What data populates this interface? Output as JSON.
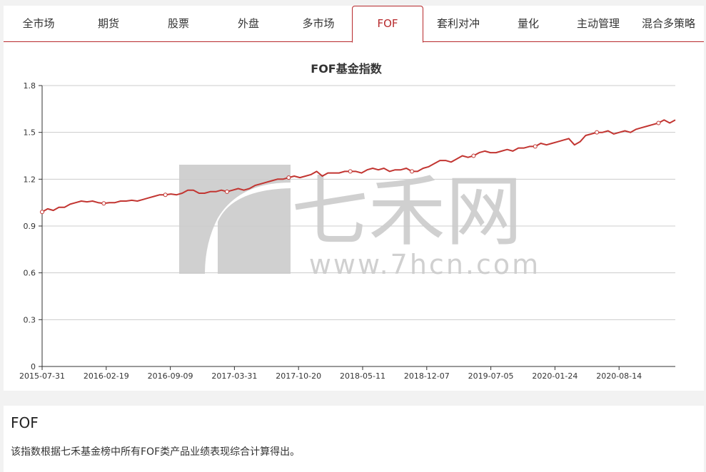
{
  "tabs": [
    {
      "label": "全市场",
      "active": false
    },
    {
      "label": "期货",
      "active": false
    },
    {
      "label": "股票",
      "active": false
    },
    {
      "label": "外盘",
      "active": false
    },
    {
      "label": "多市场",
      "active": false
    },
    {
      "label": "FOF",
      "active": true
    },
    {
      "label": "套利对冲",
      "active": false
    },
    {
      "label": "量化",
      "active": false
    },
    {
      "label": "主动管理",
      "active": false
    },
    {
      "label": "混合多策略",
      "active": false
    }
  ],
  "colors": {
    "accent": "#b7292c",
    "line": "#c23531",
    "grid": "#cccccc",
    "watermark": "#c8c8c8"
  },
  "watermark": {
    "logo_text": "七禾网",
    "url": "www.7hcn.com"
  },
  "chart_data": {
    "type": "line",
    "title": "FOF基金指数",
    "xlabel": "",
    "ylabel": "",
    "ylim": [
      0,
      1.8
    ],
    "yticks": [
      "0",
      "0.3",
      "0.6",
      "0.9",
      "1.2",
      "1.5",
      "1.8"
    ],
    "ytick_values": [
      0,
      0.3,
      0.6,
      0.9,
      1.2,
      1.5,
      1.8
    ],
    "xticks": [
      "2015-07-31",
      "2016-02-19",
      "2016-09-09",
      "2017-03-31",
      "2017-10-20",
      "2018-05-11",
      "2018-12-07",
      "2019-07-05",
      "2020-01-24",
      "2020-08-14"
    ],
    "grid": true,
    "legend": "none",
    "series": [
      {
        "values": [
          0.99,
          1.01,
          1.0,
          1.02,
          1.02,
          1.04,
          1.05,
          1.06,
          1.055,
          1.06,
          1.05,
          1.045,
          1.05,
          1.05,
          1.06,
          1.06,
          1.065,
          1.06,
          1.07,
          1.08,
          1.09,
          1.1,
          1.1,
          1.105,
          1.1,
          1.11,
          1.13,
          1.13,
          1.11,
          1.11,
          1.12,
          1.12,
          1.13,
          1.12,
          1.13,
          1.14,
          1.13,
          1.14,
          1.16,
          1.17,
          1.18,
          1.19,
          1.2,
          1.2,
          1.21,
          1.22,
          1.21,
          1.22,
          1.23,
          1.25,
          1.22,
          1.24,
          1.24,
          1.24,
          1.25,
          1.25,
          1.25,
          1.24,
          1.26,
          1.27,
          1.26,
          1.27,
          1.25,
          1.26,
          1.26,
          1.27,
          1.25,
          1.25,
          1.27,
          1.28,
          1.3,
          1.32,
          1.32,
          1.31,
          1.33,
          1.35,
          1.34,
          1.35,
          1.37,
          1.38,
          1.37,
          1.37,
          1.38,
          1.39,
          1.38,
          1.4,
          1.4,
          1.41,
          1.41,
          1.43,
          1.42,
          1.43,
          1.44,
          1.45,
          1.46,
          1.42,
          1.44,
          1.48,
          1.49,
          1.5,
          1.5,
          1.51,
          1.49,
          1.5,
          1.51,
          1.5,
          1.52,
          1.53,
          1.54,
          1.55,
          1.56,
          1.58,
          1.56,
          1.58
        ],
        "marker_indices": [
          0,
          11,
          22,
          33,
          44,
          55,
          66,
          77,
          88,
          99,
          110
        ]
      }
    ]
  },
  "description": {
    "title": "FOF",
    "text": "该指数根据七禾基金榜中所有FOF类产品业绩表现综合计算得出。"
  }
}
